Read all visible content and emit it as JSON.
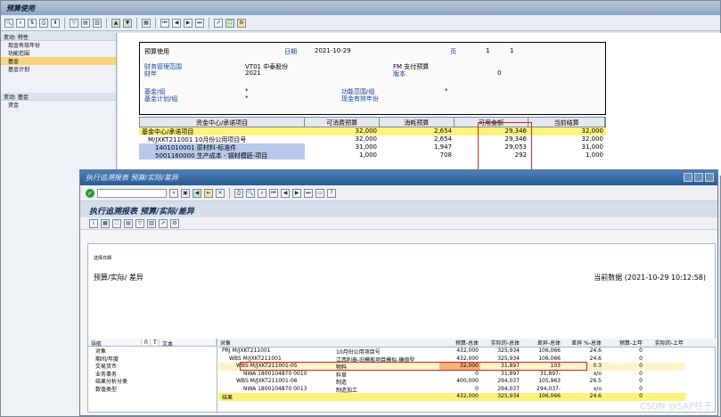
{
  "window_title": "预算使用",
  "left_pane": {
    "header1": "变动: 特性",
    "items1": [
      "现金有效年份",
      "功能范围",
      "基金",
      "基金计划"
    ],
    "header2": "变动: 基金",
    "tree_root": "资金"
  },
  "header": {
    "label_budget_use": "预算使用",
    "label_date": "日期",
    "date_value": "2021-10-29",
    "label_page": "页",
    "page_num": "1",
    "page_total": "1",
    "label_fm_area": "财务管理范围",
    "fm_area_value": "VT01 中泰股份",
    "label_fm_text": "FM 支付预算",
    "label_fiscal_year": "财年",
    "fiscal_year_value": "2021",
    "label_version": "版本",
    "version_value": "0",
    "label_fund_group": "基金/组",
    "fund_group_value": "*",
    "label_func_group": "功能范围/组",
    "func_group_value": "*",
    "label_fund_plan": "基金计划/组",
    "fund_plan_value": "*",
    "label_cash_year": "现金有效年份"
  },
  "grid": {
    "columns": [
      "资金中心/承诺项目",
      "可消费预算",
      "消耗预算",
      "可用金额",
      "当前结算"
    ],
    "rows": [
      {
        "name": "基金中心/承诺项目",
        "c2": "32,000",
        "c3": "2,654",
        "c4": "29,346",
        "c5": "32,000"
      },
      {
        "name": "M/JXKT211001  10月份公用项目号",
        "c2": "32,000",
        "c3": "2,654",
        "c4": "29,346",
        "c5": "32,000"
      },
      {
        "name": "1401010001  原材料-标准件",
        "c2": "31,000",
        "c3": "1,947",
        "c4": "29,053",
        "c5": "31,000"
      },
      {
        "name": "5001160000  生产成本 - 钢材模胚-项目",
        "c2": "1,000",
        "c3": "708",
        "c4": "292",
        "c5": "1,000"
      }
    ]
  },
  "popup": {
    "title": "执行追溯报表 预算/实际/差异",
    "report_title": "执行追溯报表 预算/实际/差异",
    "small_label": "选择日期",
    "view_label": "预算/实际/ 差异",
    "current_data": "当前数据 (2021-10-29 10:12:58)",
    "nav_headers": [
      "导航",
      "ñ",
      "T",
      "文本"
    ],
    "nav_items": [
      "对象",
      "期间/年度",
      "交易货币",
      "业务事务",
      "结果分析分类",
      "数值类型"
    ],
    "table_headers": [
      "对象",
      "",
      "预算-总体",
      "实际的-总体",
      "差异-总体",
      "差异 %-总体",
      "预算-上年",
      "实际的-上年"
    ],
    "table_rows": [
      {
        "obj": "PRJ M/JXKT211001",
        "desc": "10月份公用项目号",
        "v1": "432,000",
        "v2": "325,934",
        "v3": "106,066",
        "v4": "24.6",
        "v5": "0",
        "v6": ""
      },
      {
        "obj": "WBS M/JXKT211001",
        "desc": "江西利泰-旧模板项目模拟-确值型",
        "v1": "432,000",
        "v2": "325,934",
        "v3": "106,066",
        "v4": "24.6",
        "v5": "0",
        "v6": ""
      },
      {
        "obj": "WBS M/JXKT211001-05",
        "desc": "物料",
        "v1": "32,000",
        "v2": "31,897",
        "v3": "103",
        "v4": "0.3",
        "v5": "0",
        "v6": ""
      },
      {
        "obj": "NWA 1800104870 0010",
        "desc": "料草",
        "v1": "0",
        "v2": "31,897",
        "v3": "31,897-",
        "v4": "x/o",
        "v5": "0",
        "v6": ""
      },
      {
        "obj": "WBS M/JXKT211001-06",
        "desc": "制造",
        "v1": "400,000",
        "v2": "294,037",
        "v3": "105,963",
        "v4": "26.5",
        "v5": "0",
        "v6": ""
      },
      {
        "obj": "NWA 1800104870 0013",
        "desc": "制造加工",
        "v1": "0",
        "v2": "294,037",
        "v3": "294,037-",
        "v4": "x/o",
        "v5": "0",
        "v6": ""
      },
      {
        "obj": "结果",
        "desc": "",
        "v1": "432,000",
        "v2": "325,934",
        "v3": "106,066",
        "v4": "24.6",
        "v5": "0",
        "v6": ""
      }
    ]
  },
  "watermark": "CSDN @SAP柱子"
}
